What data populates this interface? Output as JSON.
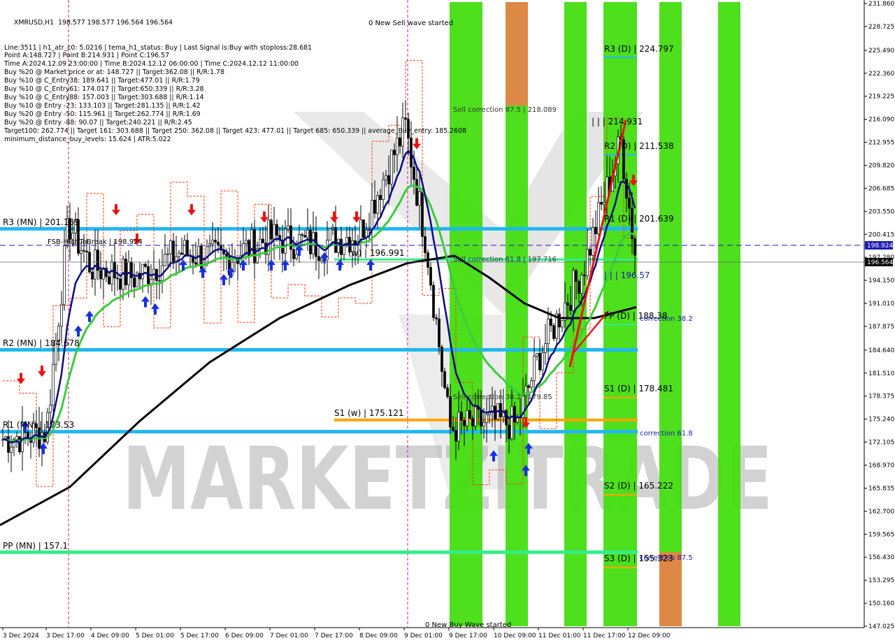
{
  "symbol_header": "XMRUSD,H1  198.577 198.577 196.564 196.564",
  "info_lines": [
    "Line:3511 | h1_atr_c0: 5.0216 | tema_h1_status: Buy | Last Signal is:Buy with stoploss:28.681",
    "Point A:148.727 | Point B:214.931 | Point C:196.57",
    "Time A:2024.12.09 23:00:00 | Time B:2024.12.12 06:00:00 | Time C:2024.12.12 11:00:00",
    "Buy %20 @ Market price or at: 148.727 || Target:362.08 || R/R:1.78",
    "Buy %10 @ C_Entry38: 189.641 || Target:477.01 || R/R:1.79",
    "Buy %10 @ C_Entry61: 174.017 || Target:650.339 || R/R:3.28",
    "Buy %10 @ C_Entry88: 157.003 || Target:303.688 || R/R:1.14",
    "Buy %10 @ Entry -23: 133.103 || Target:281.135 || R/R:1.42",
    "Buy %20 @ Entry -50: 115.961 || Target:262.774 || R/R:1.69",
    "Buy %20 @ Entry -88: 90.07 || Target:240.221 || R/R:2.45",
    "Target100: 262.774 || Target 161: 303.688 || Target 250: 362.08 || Target 423: 477.01 || Target 685: 650.339 || average_Buy_entry: 185.2608",
    "minimum_distance_buy_levels: 15.624 | ATR:5.022"
  ],
  "price_axis": [
    "231.860",
    "228.725",
    "225.490",
    "222.360",
    "219.225",
    "216.090",
    "212.955",
    "209.820",
    "206.685",
    "203.550",
    "200.415",
    "197.280",
    "194.150",
    "191.010",
    "187.875",
    "184.640",
    "181.510",
    "178.375",
    "175.240",
    "172.105",
    "168.970",
    "165.835",
    "162.700",
    "159.565",
    "156.430",
    "153.295",
    "150.160",
    "147.025"
  ],
  "time_axis": [
    "3 Dec 2024",
    "3 Dec 17:00",
    "4 Dec 09:00",
    "5 Dec 01:00",
    "5 Dec 17:00",
    "6 Dec 09:00",
    "7 Dec 01:00",
    "7 Dec 17:00",
    "8 Dec 09:00",
    "9 Dec 01:00",
    "9 Dec 17:00",
    "10 Dec 09:00",
    "11 Dec 01:00",
    "11 Dec 17:00",
    "12 Dec 09:00"
  ],
  "current_price_tag": "196.564",
  "bid_tag": "198.924",
  "levels": {
    "r3_mn": "R3 (MN) | 201.169",
    "fsb_label": "FSB-HighToBreak | 198.924",
    "r2_mn": "R2 (MN) | 184.678",
    "r1_mn": "R1 (MN) | 173.53",
    "pp_mn": "PP (MN) | 157.1",
    "s1_w": "S1 (w) | 175.121",
    "w_mark": "(w) | 196.991",
    "r3_d": "R3 (D) | 224.797",
    "r2_d": "R2 (D) | 211.538",
    "r1_d": "R1 (D) | 201.639",
    "pp_d": "PP (D) | 188.38",
    "s1_d": "S1 (D) | 178.481",
    "s2_d": "S2 (D) | 165.222",
    "s3_d": "S3 (D) | 155.323"
  },
  "annotations": {
    "sell_wave": "0 New Sell wave started",
    "buy_wave": "0 New Buy Wave started",
    "sell_corr_875": "Sell correction 87.5 | 218.089",
    "sell_corr_618": "Sell correction 61.8 | 197.716",
    "sell_corr_382": "Sell correction 38.2 | 179.85",
    "point_b": "| | | 214.931",
    "point_c": "| | | 196.57",
    "corr_382": "correction 38.2",
    "corr_618": "correction 61.8",
    "corr_875": "correction 87.5"
  },
  "watermark": "MARKETZITRADE",
  "colors": {
    "cyan_level": "#1fb8f0",
    "green_level": "#33ee88",
    "orange_level": "#ffa500",
    "green_band": "#44dd11",
    "orange_band": "#dd8844",
    "ma_black": "#000000",
    "ma_navy": "#0b0b80",
    "ma_green": "#3acd3a",
    "tema_red": "#ff3300",
    "arrow_up": "#1530e0",
    "arrow_down": "#ee1111"
  },
  "chart_data": {
    "type": "candlestick",
    "title": "XMRUSD,H1",
    "ylim": [
      147.025,
      231.86
    ],
    "points": {
      "A": 148.727,
      "B": 214.931,
      "C": 196.57
    },
    "horizontal_levels": [
      {
        "name": "R3 (MN)",
        "value": 201.169
      },
      {
        "name": "FSB-HighToBreak",
        "value": 198.924
      },
      {
        "name": "R2 (MN)",
        "value": 184.678
      },
      {
        "name": "R1 (MN)",
        "value": 173.53
      },
      {
        "name": "PP (MN)",
        "value": 157.1
      },
      {
        "name": "S1 (w)",
        "value": 175.121
      },
      {
        "name": "(w)",
        "value": 196.991
      },
      {
        "name": "R3 (D)",
        "value": 224.797
      },
      {
        "name": "R2 (D)",
        "value": 211.538
      },
      {
        "name": "R1 (D)",
        "value": 201.639
      },
      {
        "name": "PP (D)",
        "value": 188.38
      },
      {
        "name": "S1 (D)",
        "value": 178.481
      },
      {
        "name": "S2 (D)",
        "value": 165.222
      },
      {
        "name": "S3 (D)",
        "value": 155.323
      }
    ],
    "close_anchors": [
      {
        "time": "3 Dec 2024",
        "close": 172.5
      },
      {
        "time": "3 Dec 17:00",
        "close": 173.5
      },
      {
        "time": "3 Dec 20:00",
        "close": 202.0
      },
      {
        "time": "4 Dec 09:00",
        "close": 196.0
      },
      {
        "time": "5 Dec 01:00",
        "close": 194.5
      },
      {
        "time": "5 Dec 17:00",
        "close": 198.0
      },
      {
        "time": "6 Dec 09:00",
        "close": 197.0
      },
      {
        "time": "7 Dec 01:00",
        "close": 200.0
      },
      {
        "time": "7 Dec 17:00",
        "close": 199.0
      },
      {
        "time": "8 Dec 09:00",
        "close": 200.5
      },
      {
        "time": "9 Dec 01:00",
        "close": 215.0
      },
      {
        "time": "9 Dec 09:00",
        "close": 199.0
      },
      {
        "time": "9 Dec 17:00",
        "close": 174.0
      },
      {
        "time": "10 Dec 09:00",
        "close": 175.0
      },
      {
        "time": "10 Dec 17:00",
        "close": 174.5
      },
      {
        "time": "11 Dec 01:00",
        "close": 184.0
      },
      {
        "time": "11 Dec 17:00",
        "close": 196.0
      },
      {
        "time": "12 Dec 06:00",
        "close": 213.0
      },
      {
        "time": "12 Dec 11:00",
        "close": 196.564
      }
    ]
  }
}
